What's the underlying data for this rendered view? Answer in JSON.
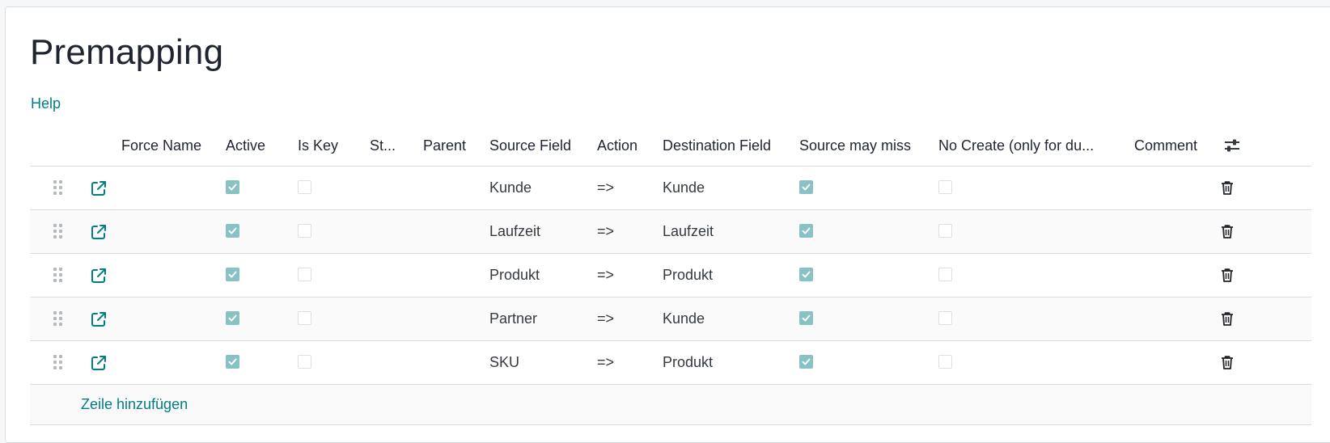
{
  "page": {
    "title": "Premapping",
    "help_label": "Help"
  },
  "table": {
    "headers": {
      "force_name": "Force Name",
      "active": "Active",
      "is_key": "Is Key",
      "st": "St...",
      "parent": "Parent",
      "source_field": "Source Field",
      "action": "Action",
      "destination_field": "Destination Field",
      "source_may_miss": "Source may miss",
      "no_create": "No Create (only for du...",
      "comment": "Comment"
    },
    "rows": [
      {
        "force_name": "",
        "active": true,
        "is_key": false,
        "source_field": "Kunde",
        "action": "=>",
        "destination_field": "Kunde",
        "source_may_miss": true,
        "no_create": false,
        "comment": ""
      },
      {
        "force_name": "",
        "active": true,
        "is_key": false,
        "source_field": "Laufzeit",
        "action": "=>",
        "destination_field": "Laufzeit",
        "source_may_miss": true,
        "no_create": false,
        "comment": ""
      },
      {
        "force_name": "",
        "active": true,
        "is_key": false,
        "source_field": "Produkt",
        "action": "=>",
        "destination_field": "Produkt",
        "source_may_miss": true,
        "no_create": false,
        "comment": ""
      },
      {
        "force_name": "",
        "active": true,
        "is_key": false,
        "source_field": "Partner",
        "action": "=>",
        "destination_field": "Kunde",
        "source_may_miss": true,
        "no_create": false,
        "comment": ""
      },
      {
        "force_name": "",
        "active": true,
        "is_key": false,
        "source_field": "SKU",
        "action": "=>",
        "destination_field": "Produkt",
        "source_may_miss": true,
        "no_create": false,
        "comment": ""
      }
    ],
    "add_line_label": "Zeile hinzufügen"
  },
  "icons": {
    "drag": "drag-handle-icon",
    "open": "external-link-icon",
    "delete": "trash-icon",
    "optional_columns": "sliders-icon"
  },
  "colors": {
    "accent": "#017e84",
    "checkbox_checked": "#89c2c4",
    "border": "#d8dde3"
  }
}
